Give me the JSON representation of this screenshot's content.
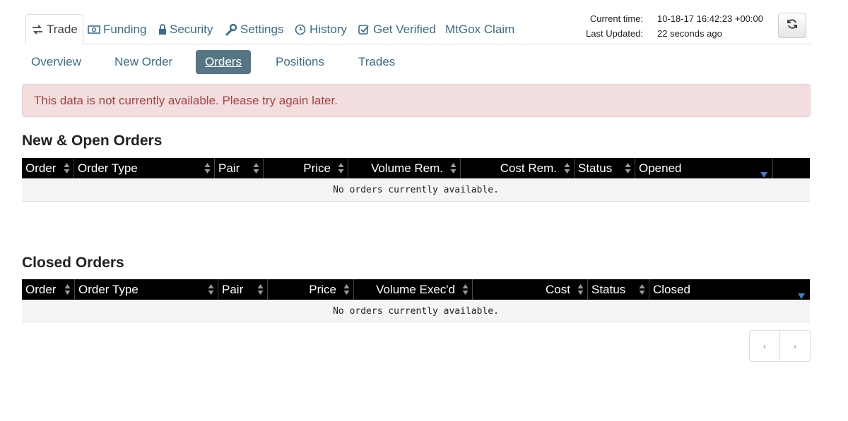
{
  "top_tabs": [
    {
      "label": "Trade",
      "icon": "exchange-icon"
    },
    {
      "label": "Funding",
      "icon": "money-icon"
    },
    {
      "label": "Security",
      "icon": "lock-icon"
    },
    {
      "label": "Settings",
      "icon": "wrench-icon"
    },
    {
      "label": "History",
      "icon": "clock-icon"
    },
    {
      "label": "Get Verified",
      "icon": "check-square-icon"
    },
    {
      "label": "MtGox Claim",
      "icon": ""
    }
  ],
  "time_info": {
    "current_label": "Current time:",
    "current_value": "10-18-17 16:42:23 +00:00",
    "updated_label": "Last Updated:",
    "updated_value": "22 seconds ago"
  },
  "refresh_icon": "refresh-icon",
  "sub_tabs": [
    "Overview",
    "New Order",
    "Orders",
    "Positions",
    "Trades"
  ],
  "active_sub_tab": "Orders",
  "alert": "This data is not currently available. Please try again later.",
  "open_orders": {
    "title": "New & Open Orders",
    "columns": [
      "Order",
      "Order Type",
      "Pair",
      "Price",
      "Volume Rem.",
      "Cost Rem.",
      "Status",
      "Opened",
      ""
    ],
    "empty_text": "No orders currently available."
  },
  "closed_orders": {
    "title": "Closed Orders",
    "columns": [
      "Order",
      "Order Type",
      "Pair",
      "Price",
      "Volume Exec'd",
      "Cost",
      "Status",
      "Closed"
    ],
    "empty_text": "No orders currently available."
  },
  "pagination": {
    "prev": "‹",
    "next": "›"
  },
  "colors": {
    "link": "#3a6d8c",
    "active_subtab": "#567585",
    "alert_bg": "#f2dede",
    "alert_text": "#a94442",
    "sort_desc": "#3b7fd0"
  }
}
